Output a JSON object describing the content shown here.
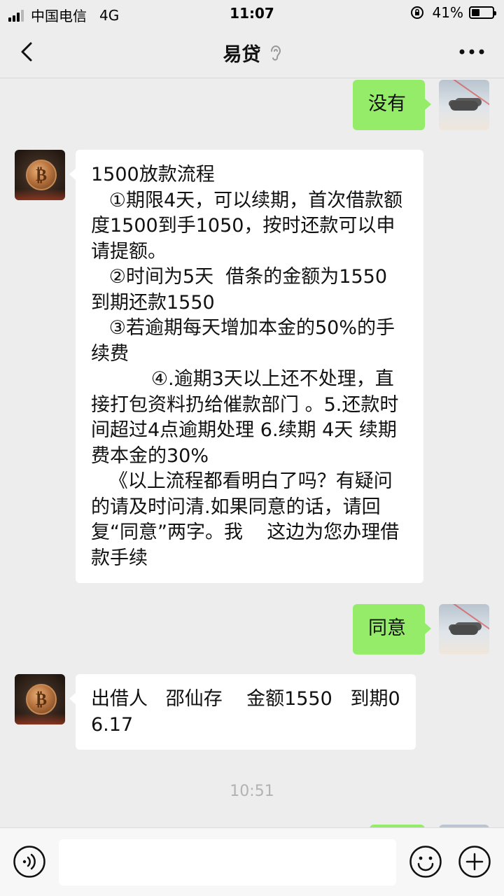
{
  "status_bar": {
    "carrier": "中国电信",
    "network": "4G",
    "time": "11:07",
    "battery_percent": "41%",
    "battery_level": 0.41
  },
  "nav": {
    "title": "易贷",
    "back_icon": "chevron-left-icon",
    "more_icon": "more-dots-icon",
    "mute_icon": "ear-icon"
  },
  "messages": [
    {
      "side": "right",
      "avatar": "cloud-avatar",
      "text": "没有"
    },
    {
      "side": "left",
      "avatar": "bitcoin-avatar",
      "text": "1500放款流程\n   ①期限4天，可以续期，首次借款额度1500到手1050，按时还款可以申请提额。\n   ②时间为5天  借条的金额为1550 到期还款1550\n   ③若逾期每天增加本金的50%的手续费\n          ④.逾期3天以上还不处理，直接打包资料扔给催款部门 。5.还款时间超过4点逾期处理 6.续期 4天 续期费本金的30%\n   《以上流程都看明白了吗？有疑问的请及时问清.如果同意的话，请回复“同意”两字。我    这边为您办理借款手续"
    },
    {
      "side": "right",
      "avatar": "cloud-avatar",
      "text": "同意"
    },
    {
      "side": "left",
      "avatar": "bitcoin-avatar",
      "text": "出借人   邵仙存    金额1550   到期06.17"
    }
  ],
  "timestamp": "10:51",
  "input": {
    "value": "",
    "placeholder": ""
  },
  "colors": {
    "background": "#ededed",
    "sent_bubble": "#95ec69",
    "received_bubble": "#ffffff"
  }
}
